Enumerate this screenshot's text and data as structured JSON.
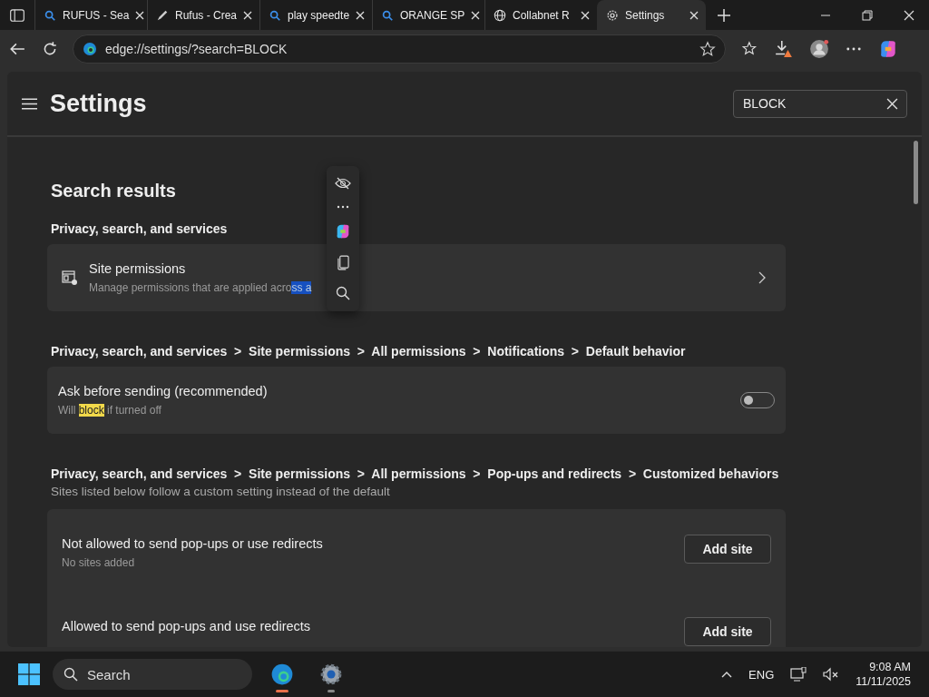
{
  "tabs": [
    {
      "title": "RUFUS - Sea",
      "kind": "search",
      "selected": false
    },
    {
      "title": "Rufus - Crea",
      "kind": "pen",
      "selected": false
    },
    {
      "title": "play speedte",
      "kind": "search",
      "selected": false
    },
    {
      "title": "ORANGE SP",
      "kind": "search",
      "selected": false
    },
    {
      "title": "Collabnet R",
      "kind": "globe",
      "selected": false
    },
    {
      "title": "Settings",
      "kind": "gear",
      "selected": true
    }
  ],
  "address_bar": {
    "url": "edge://settings/?search=BLOCK"
  },
  "settings": {
    "title": "Settings",
    "search": {
      "value": "BLOCK"
    },
    "heading": "Search results",
    "sections": [
      {
        "kind": "link",
        "breadcrumb": "Privacy, search, and services",
        "title": "Site permissions",
        "description": [
          {
            "text": "Manage permissions that are applied acro",
            "selected": false
          },
          {
            "text": "ss a",
            "selected": true
          }
        ]
      },
      {
        "kind": "toggle",
        "breadcrumb": "Privacy, search, and services  >  Site permissions  >  All permissions  >  Notifications  >  Default behavior",
        "title": "Ask before sending (recommended)",
        "description": [
          {
            "text": "Will ",
            "match": false
          },
          {
            "text": "block",
            "match": true
          },
          {
            "text": " if turned off",
            "match": false
          }
        ],
        "on": false
      },
      {
        "kind": "list",
        "breadcrumb": "Privacy, search, and services  >  Site permissions  >  All permissions  >  Pop-ups and redirects  >  Customized behaviors",
        "subtitle": "Sites listed below follow a custom setting instead of the default",
        "rows": [
          {
            "title": "Not allowed to send pop-ups or use redirects",
            "note": "No sites added",
            "button": "Add site"
          },
          {
            "title": "Allowed to send pop-ups and use redirects",
            "button": "Add site"
          }
        ]
      }
    ]
  },
  "taskbar": {
    "search": {
      "placeholder": "Search"
    },
    "apps": [
      {
        "kind": "edge",
        "running": true
      },
      {
        "kind": "settings",
        "running": true
      }
    ],
    "language": "ENG",
    "time": "9:08 AM",
    "date": "11/11/2025"
  }
}
